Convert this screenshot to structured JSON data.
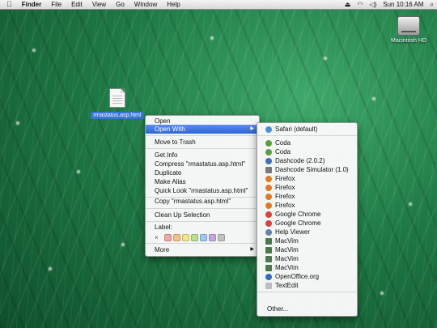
{
  "menubar": {
    "apple": "",
    "items": [
      "Finder",
      "File",
      "Edit",
      "View",
      "Go",
      "Window",
      "Help"
    ],
    "right": {
      "eject": "⏏",
      "wifi": "◠",
      "volume": "◁)",
      "clock": "Sun 10:16 AM",
      "search": "⌕"
    }
  },
  "desktop": {
    "hd_label": "Macintosh HD",
    "file_label": "rmastatus.asp.html"
  },
  "context_menu": {
    "items": [
      {
        "label": "Open"
      },
      {
        "label": "Open With",
        "submenu": true
      },
      {
        "label": "Move to Trash"
      },
      {
        "label": "Get Info"
      },
      {
        "label": "Compress \"rmastatus.asp.html\""
      },
      {
        "label": "Duplicate"
      },
      {
        "label": "Make Alias"
      },
      {
        "label": "Quick Look \"rmastatus.asp.html\""
      },
      {
        "label": "Copy \"rmastatus.asp.html\""
      },
      {
        "label": "Clean Up Selection"
      },
      {
        "label": "Label:"
      },
      {
        "label": "More",
        "submenu": true
      }
    ],
    "label_x": "×",
    "label_colors": [
      "#f2a6a6",
      "#f5c08a",
      "#f3e48a",
      "#b8e08c",
      "#9cc8f2",
      "#c4a6e6",
      "#c2c2c2"
    ]
  },
  "open_with": {
    "items": [
      {
        "label": "Safari (default)",
        "icon": "safari-icon",
        "color": "#4d8fd6"
      },
      {
        "label": "Coda",
        "icon": "coda-icon",
        "color": "#5aa03c"
      },
      {
        "label": "Coda",
        "icon": "coda-icon",
        "color": "#5aa03c"
      },
      {
        "label": "Dashcode (2.0.2)",
        "icon": "dashcode-icon",
        "color": "#3e6fb8"
      },
      {
        "label": "Dashcode Simulator (1.0)",
        "icon": "dashcode-simulator-icon",
        "color": "#7a7a7a"
      },
      {
        "label": "Firefox",
        "icon": "firefox-icon",
        "color": "#e07a20"
      },
      {
        "label": "Firefox",
        "icon": "firefox-icon",
        "color": "#e07a20"
      },
      {
        "label": "Firefox",
        "icon": "firefox-icon",
        "color": "#e07a20"
      },
      {
        "label": "Firefox",
        "icon": "firefox-icon",
        "color": "#e07a20"
      },
      {
        "label": "Google Chrome",
        "icon": "chrome-icon",
        "color": "#d9423a"
      },
      {
        "label": "Google Chrome",
        "icon": "chrome-icon",
        "color": "#d9423a"
      },
      {
        "label": "Help Viewer",
        "icon": "help-viewer-icon",
        "color": "#6a7fa8"
      },
      {
        "label": "MacVim",
        "icon": "macvim-icon",
        "color": "#4a7a4a"
      },
      {
        "label": "MacVim",
        "icon": "macvim-icon",
        "color": "#4a7a4a"
      },
      {
        "label": "MacVim",
        "icon": "macvim-icon",
        "color": "#4a7a4a"
      },
      {
        "label": "MacVim",
        "icon": "macvim-icon",
        "color": "#4a7a4a"
      },
      {
        "label": "OpenOffice.org",
        "icon": "openoffice-icon",
        "color": "#2f6fc0"
      },
      {
        "label": "TextEdit",
        "icon": "textedit-icon",
        "color": "#bdbdbd"
      },
      {
        "label": "Other...",
        "icon": "",
        "color": ""
      }
    ]
  },
  "colors": {
    "highlight": "#2f64d6",
    "selection": "#3875d7"
  }
}
